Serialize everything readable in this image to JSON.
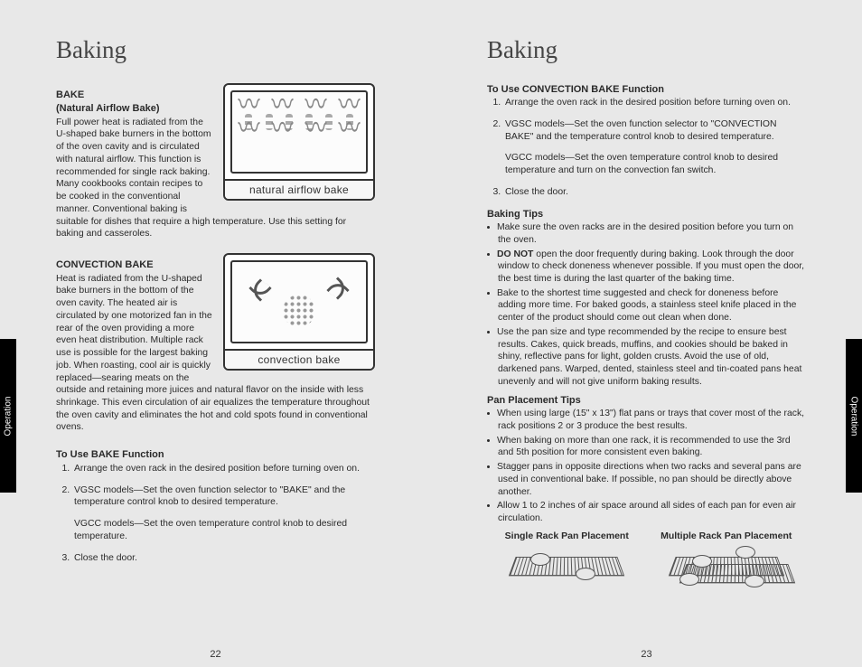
{
  "tabs": {
    "left": "Operation",
    "right": "Operation"
  },
  "left": {
    "title": "Baking",
    "bake": {
      "heading": "BAKE",
      "sub": "(Natural Airflow Bake)",
      "body": "Full power heat is radiated from the U-shaped bake burners in the bottom of the oven cavity and is circulated with natural airflow. This function is recommended for single rack baking. Many cookbooks contain recipes to be cooked in the conventional manner. Conventional baking is suitable for dishes that require a high temperature. Use this setting for baking and casseroles.",
      "figcap": "natural airflow bake"
    },
    "conv": {
      "heading": "CONVECTION BAKE",
      "body": "Heat is radiated from the U-shaped bake burners in the bottom of the oven cavity. The heated air is circulated by one motorized fan in the rear of the oven providing a more even heat distribution. Multiple rack use is possible for the largest baking job. When roasting, cool air is quickly replaced—searing meats on the outside and retaining more juices and natural flavor on the inside with less shrinkage. This even circulation of air equalizes the temperature throughout the oven cavity and eliminates the hot and cold spots found in conventional ovens.",
      "figcap": "convection bake"
    },
    "useBake": {
      "heading": "To Use BAKE Function",
      "step1": "Arrange the oven rack in the desired position before turning oven on.",
      "step2a": "VGSC models—Set the oven function selector to \"BAKE\" and the temperature control knob to desired temperature.",
      "step2b": "VGCC models—Set the oven temperature control knob to desired temperature.",
      "step3": "Close the door."
    },
    "pagenum": "22"
  },
  "right": {
    "title": "Baking",
    "useConv": {
      "heading": "To Use CONVECTION BAKE Function",
      "step1": "Arrange the oven rack in the desired position before turning oven on.",
      "step2a": "VGSC models—Set the oven function selector to \"CONVECTION BAKE\" and the temperature control knob to desired temperature.",
      "step2b": "VGCC models—Set the oven temperature control knob to desired temperature and turn on the convection fan switch.",
      "step3": "Close the door."
    },
    "tips": {
      "heading": "Baking Tips",
      "b1": "Make sure the oven racks are in the desired position before you turn on the oven.",
      "b2_strong": "DO NOT",
      "b2_rest": " open the door frequently during baking. Look through the door window to check doneness whenever possible. If you must open the door, the best time is during the last quarter of the baking time.",
      "b3": "Bake to the shortest time suggested and check for doneness before adding more time. For baked goods, a stainless steel knife placed in the center of the product should come out clean when done.",
      "b4": "Use the pan size and type recommended by the recipe to ensure best results. Cakes, quick breads, muffins, and cookies should be baked in shiny, reflective pans for light, golden crusts. Avoid the use of old, darkened pans. Warped, dented, stainless steel and tin-coated pans heat unevenly and will not give uniform baking results."
    },
    "pan": {
      "heading": "Pan Placement Tips",
      "b1": "When using large (15\" x 13\") flat pans or trays that cover most of the rack, rack positions 2 or 3 produce the best results.",
      "b2": "When baking on more than one rack, it is recommended to use the 3rd and 5th position for more consistent even baking.",
      "b3": "Stagger pans in opposite directions when two racks and several pans are used in conventional bake. If possible, no pan should be directly above another.",
      "b4": "Allow 1 to 2 inches of air space around all sides of each pan for even air circulation."
    },
    "figs": {
      "single": "Single Rack Pan Placement",
      "multi": "Multiple Rack Pan Placement"
    },
    "pagenum": "23"
  }
}
